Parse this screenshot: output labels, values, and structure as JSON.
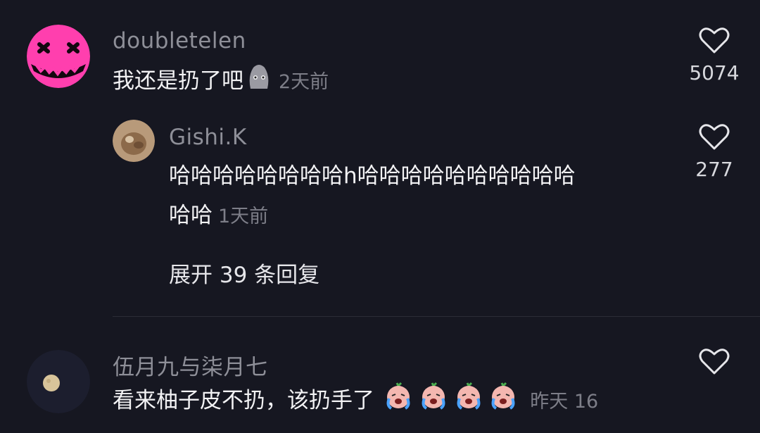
{
  "comments": [
    {
      "username": "doubletelen",
      "text": "我还是扔了吧",
      "time": "2天前",
      "likes": "5074",
      "emoji": "moai-face-emoji"
    },
    {
      "username": "Gishi.K",
      "text_line1": "哈哈哈哈哈哈哈哈h哈哈哈哈哈哈哈哈哈哈",
      "text_line2": "哈哈",
      "time": "1天前",
      "likes": "277",
      "expand_label": "展开 39 条回复"
    },
    {
      "username": "伍月九与柒月七",
      "text": "看来柚子皮不扔，该扔手了",
      "time": "昨天 16",
      "emoji": "crying-face-emoji"
    }
  ],
  "colors": {
    "background": "#161721",
    "username": "#8e8f98",
    "text": "#f2f2f4",
    "meta": "#7d7e88",
    "avatar1": "#ff3fae"
  }
}
